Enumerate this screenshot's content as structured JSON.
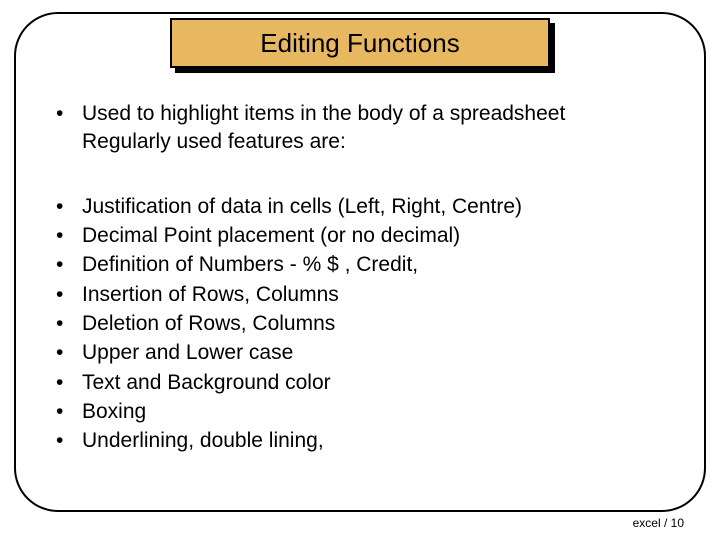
{
  "title": "Editing Functions",
  "intro": {
    "line1": "Used to highlight items in the body of a spreadsheet",
    "line2": "Regularly used features are:"
  },
  "features": [
    "Justification of data in cells (Left, Right, Centre)",
    "Decimal Point placement (or no decimal)",
    "Definition of Numbers - %  $  ,  Credit,",
    "Insertion of Rows, Columns",
    "Deletion of Rows, Columns",
    "Upper and Lower case",
    "Text and Background color",
    "Boxing",
    "Underlining, double lining,"
  ],
  "footer": "excel / 10",
  "bullet_char": "•"
}
